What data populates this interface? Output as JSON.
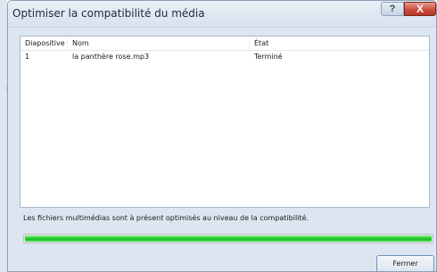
{
  "dialog": {
    "title": "Optimiser la compatibilité du média",
    "help_label": "?",
    "close_label": "X"
  },
  "table": {
    "headers": [
      "Diapositive",
      "Nom",
      "État"
    ],
    "rows": [
      {
        "slide": "1",
        "name": "la panthère rose.mp3",
        "state": "Terminé"
      }
    ]
  },
  "status": {
    "message": "Les fichiers multimédias sont à présent optimisés au niveau de la compatibilité."
  },
  "progress": {
    "fraction": 1.0,
    "color": "#1fcf2a"
  },
  "buttons": {
    "close_label": "Fermer"
  }
}
